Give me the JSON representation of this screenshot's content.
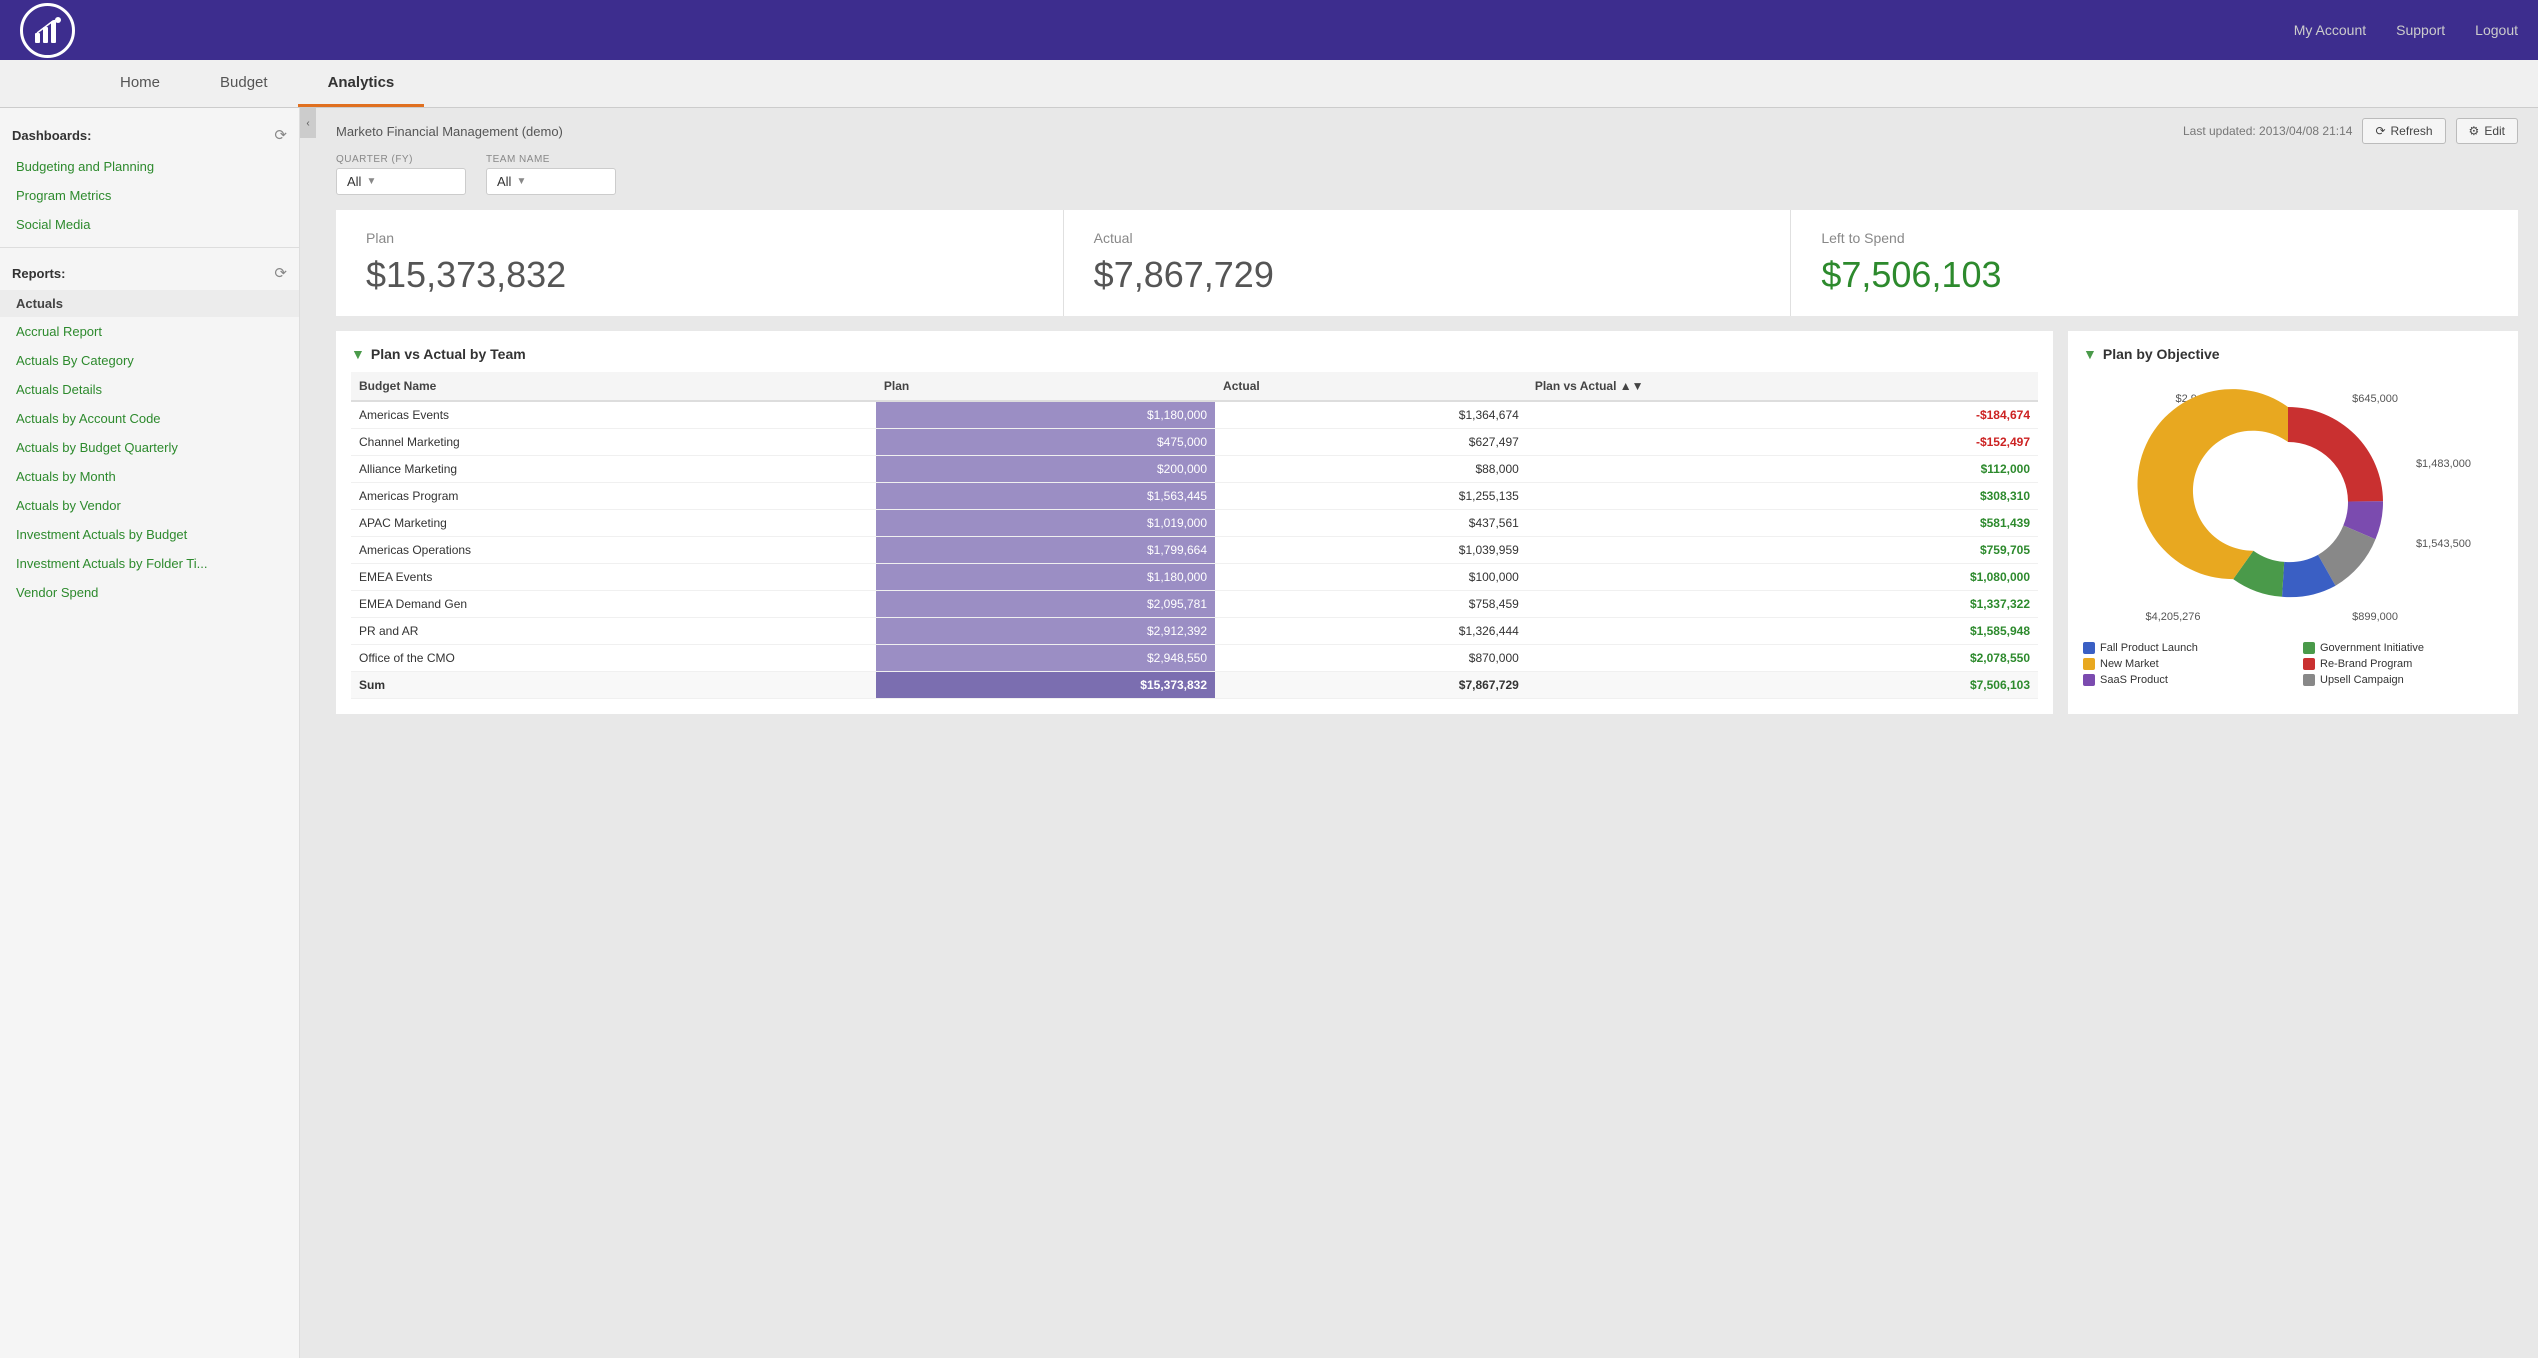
{
  "topnav": {
    "links": [
      {
        "label": "My Account",
        "name": "my-account-link"
      },
      {
        "label": "Support",
        "name": "support-link"
      },
      {
        "label": "Logout",
        "name": "logout-link"
      }
    ]
  },
  "mainnav": {
    "tabs": [
      {
        "label": "Home",
        "name": "home-tab",
        "active": false
      },
      {
        "label": "Budget",
        "name": "budget-tab",
        "active": false
      },
      {
        "label": "Analytics",
        "name": "analytics-tab",
        "active": true
      }
    ]
  },
  "page": {
    "title": "Marketo Financial Management (demo)",
    "last_updated_label": "Last updated: 2013/04/08 21:14",
    "refresh_btn": "Refresh",
    "edit_btn": "Edit"
  },
  "sidebar": {
    "dashboards_label": "Dashboards:",
    "reports_label": "Reports:",
    "dashboard_items": [
      {
        "label": "Budgeting and Planning",
        "name": "budgeting-planning"
      },
      {
        "label": "Program Metrics",
        "name": "program-metrics"
      },
      {
        "label": "Social Media",
        "name": "social-media"
      }
    ],
    "reports_category": "Actuals",
    "report_items": [
      {
        "label": "Accrual Report",
        "name": "accrual-report"
      },
      {
        "label": "Actuals By Category",
        "name": "actuals-by-category"
      },
      {
        "label": "Actuals Details",
        "name": "actuals-details"
      },
      {
        "label": "Actuals by Account Code",
        "name": "actuals-by-account-code"
      },
      {
        "label": "Actuals by Budget Quarterly",
        "name": "actuals-by-budget-quarterly"
      },
      {
        "label": "Actuals by Month",
        "name": "actuals-by-month"
      },
      {
        "label": "Actuals by Vendor",
        "name": "actuals-by-vendor"
      },
      {
        "label": "Investment Actuals by Budget",
        "name": "investment-actuals-by-budget"
      },
      {
        "label": "Investment Actuals by Folder Ti...",
        "name": "investment-actuals-by-folder"
      },
      {
        "label": "Vendor Spend",
        "name": "vendor-spend"
      }
    ]
  },
  "filters": {
    "quarter_label": "QUARTER (FY)",
    "quarter_value": "All",
    "team_label": "TEAM NAME",
    "team_value": "All"
  },
  "kpis": {
    "plan_label": "Plan",
    "plan_value": "$15,373,832",
    "actual_label": "Actual",
    "actual_value": "$7,867,729",
    "left_to_spend_label": "Left to Spend",
    "left_to_spend_value": "$7,506,103"
  },
  "table_report": {
    "title": "Plan vs Actual by Team",
    "columns": [
      "Budget Name",
      "Plan",
      "Actual",
      "Plan vs Actual"
    ],
    "rows": [
      {
        "name": "Americas Events",
        "plan": "$1,180,000",
        "actual": "$1,364,674",
        "pvsa": "-$184,674",
        "pvsa_type": "red"
      },
      {
        "name": "Channel Marketing",
        "plan": "$475,000",
        "actual": "$627,497",
        "pvsa": "-$152,497",
        "pvsa_type": "red"
      },
      {
        "name": "Alliance Marketing",
        "plan": "$200,000",
        "actual": "$88,000",
        "pvsa": "$112,000",
        "pvsa_type": "green"
      },
      {
        "name": "Americas Program",
        "plan": "$1,563,445",
        "actual": "$1,255,135",
        "pvsa": "$308,310",
        "pvsa_type": "green"
      },
      {
        "name": "APAC Marketing",
        "plan": "$1,019,000",
        "actual": "$437,561",
        "pvsa": "$581,439",
        "pvsa_type": "green"
      },
      {
        "name": "Americas Operations",
        "plan": "$1,799,664",
        "actual": "$1,039,959",
        "pvsa": "$759,705",
        "pvsa_type": "green"
      },
      {
        "name": "EMEA Events",
        "plan": "$1,180,000",
        "actual": "$100,000",
        "pvsa": "$1,080,000",
        "pvsa_type": "green"
      },
      {
        "name": "EMEA Demand Gen",
        "plan": "$2,095,781",
        "actual": "$758,459",
        "pvsa": "$1,337,322",
        "pvsa_type": "green"
      },
      {
        "name": "PR and AR",
        "plan": "$2,912,392",
        "actual": "$1,326,444",
        "pvsa": "$1,585,948",
        "pvsa_type": "green"
      },
      {
        "name": "Office of the CMO",
        "plan": "$2,948,550",
        "actual": "$870,000",
        "pvsa": "$2,078,550",
        "pvsa_type": "green"
      }
    ],
    "sum_row": {
      "label": "Sum",
      "plan": "$15,373,832",
      "actual": "$7,867,729",
      "pvsa": "$7,506,103",
      "pvsa_type": "green"
    }
  },
  "donut_chart": {
    "title": "Plan by Objective",
    "segments": [
      {
        "label": "Fall Product Launch",
        "value": 1543500,
        "color": "#3a5fc4",
        "display": "$1,543,500"
      },
      {
        "label": "New Market",
        "value": 4205276,
        "color": "#e8a820",
        "display": "$4,205,276"
      },
      {
        "label": "SaaS Product",
        "value": 645000,
        "color": "#7b4baf",
        "display": "$645,000"
      },
      {
        "label": "Government Initiative",
        "value": 899000,
        "color": "#4a9a4a",
        "display": "$899,000"
      },
      {
        "label": "Re-Brand Program",
        "value": 2945000,
        "color": "#c93030",
        "display": "$2,945,000"
      },
      {
        "label": "Upsell Campaign",
        "value": 1483000,
        "color": "#888888",
        "display": "$1,483,000"
      }
    ],
    "labels_outer": [
      {
        "text": "$2,945,000",
        "pos": "top-left"
      },
      {
        "text": "$645,000",
        "pos": "top-right"
      },
      {
        "text": "$1,483,000",
        "pos": "right-top"
      },
      {
        "text": "$1,543,500",
        "pos": "right-bottom"
      },
      {
        "text": "$899,000",
        "pos": "bottom-right"
      },
      {
        "text": "$4,205,276",
        "pos": "bottom-left"
      }
    ]
  }
}
